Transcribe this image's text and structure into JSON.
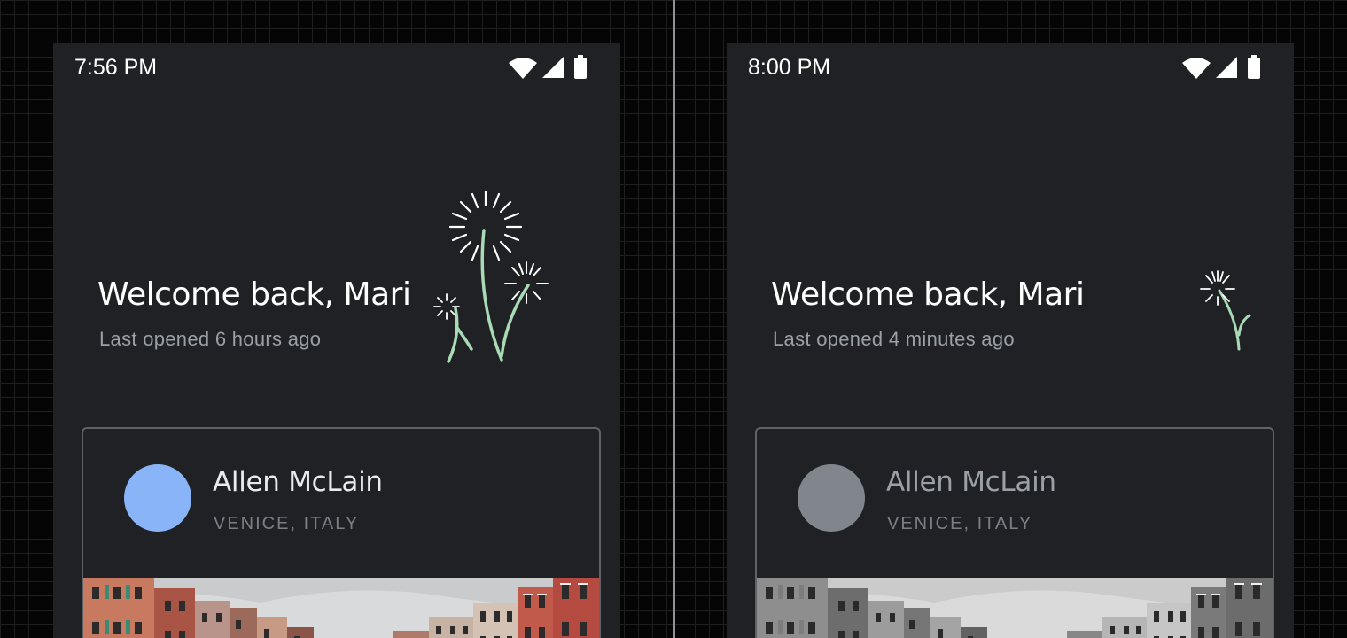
{
  "screens": [
    {
      "status_time": "7:56 PM",
      "welcome": "Welcome back, Mari",
      "last_opened": "Last opened 6 hours ago",
      "contact": {
        "name": "Allen McLain",
        "location": "VENICE, ITALY"
      },
      "colors": {
        "avatar": "#8ab4f8",
        "name": "#e8eaed",
        "stem": "#a8dab5",
        "photo": "color"
      },
      "icons": [
        "wifi-icon",
        "cellular-signal-icon",
        "battery-icon"
      ]
    },
    {
      "status_time": "8:00 PM",
      "welcome": "Welcome back, Mari",
      "last_opened": "Last opened 4 minutes ago",
      "contact": {
        "name": "Allen McLain",
        "location": "VENICE, ITALY"
      },
      "colors": {
        "avatar": "#80868b",
        "name": "#9aa0a6",
        "stem": "#a8dab5",
        "photo": "grayscale"
      },
      "icons": [
        "wifi-icon",
        "cellular-signal-icon",
        "battery-icon"
      ]
    }
  ]
}
